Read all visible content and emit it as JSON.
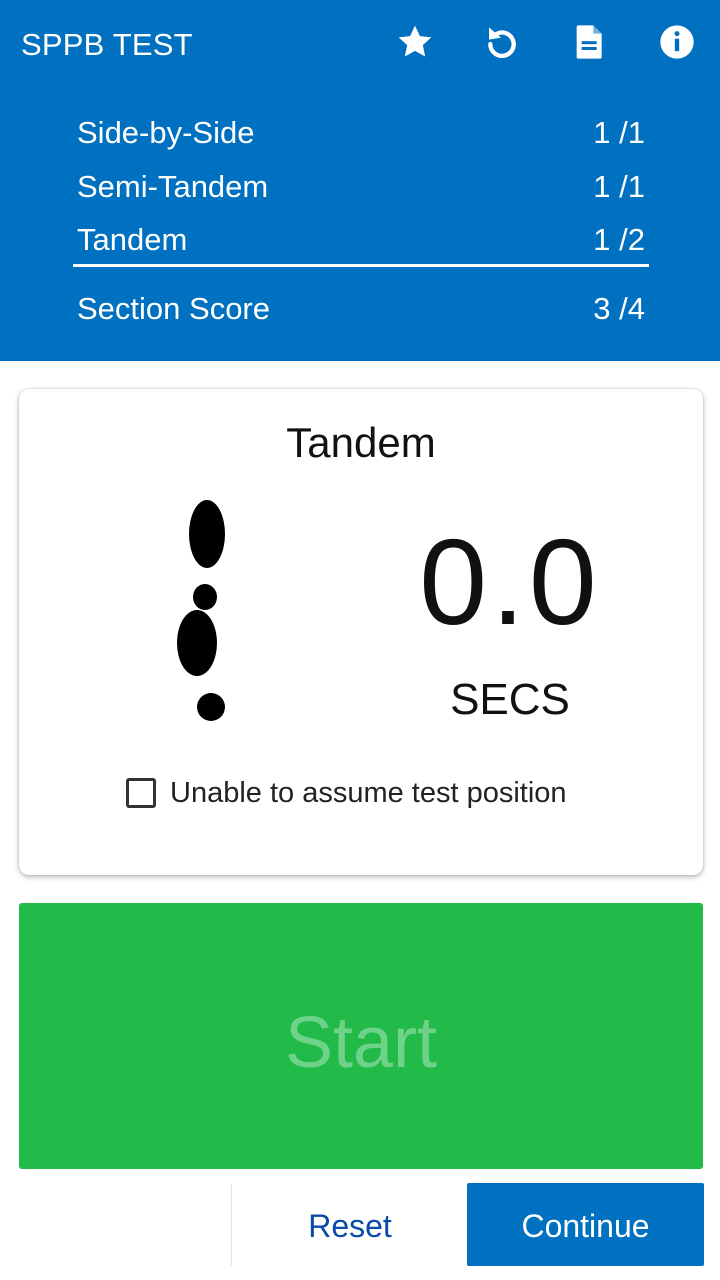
{
  "app": {
    "title": "SPPB TEST",
    "toolbar_icons": [
      "star-icon",
      "undo-icon",
      "document-icon",
      "info-icon"
    ],
    "colors": {
      "primary": "#0070c0",
      "start_green": "#22bb4a",
      "reset_text": "#0a4aa8"
    }
  },
  "scores": {
    "items": [
      {
        "label": "Side-by-Side",
        "value": "1 /1"
      },
      {
        "label": "Semi-Tandem",
        "value": "1 /1"
      },
      {
        "label": "Tandem",
        "value": "1 /2"
      }
    ],
    "section": {
      "label": "Section Score",
      "value": "3 /4"
    }
  },
  "test": {
    "title": "Tandem",
    "icon": "tandem-feet-icon",
    "timer_value": "0.0",
    "timer_unit": "SECS",
    "checkbox_label": "Unable to assume test position",
    "checkbox_checked": false
  },
  "buttons": {
    "start": "Start",
    "reset": "Reset",
    "continue": "Continue"
  }
}
